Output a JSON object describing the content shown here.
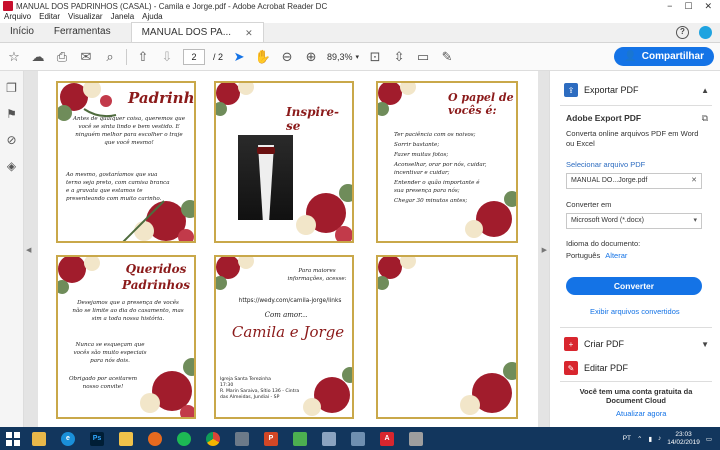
{
  "window": {
    "title": "MANUAL DOS PADRINHOS (CASAL) - Camila e Jorge.pdf - Adobe Acrobat Reader DC",
    "controls": [
      "−",
      "☐",
      "✕"
    ]
  },
  "menu": [
    "Arquivo",
    "Editar",
    "Visualizar",
    "Janela",
    "Ajuda"
  ],
  "tabs": {
    "home": "Início",
    "tools": "Ferramentas",
    "document": "MANUAL DOS PA..."
  },
  "toolbar": {
    "page_current": "2",
    "page_total": "/ 2",
    "zoom": "89,3%",
    "share_label": "Compartilhar"
  },
  "cards": {
    "padrinho": {
      "title": "Padrinho",
      "text1": "Antes de qualquer coisa, queremos que você se sinta lindo e bem vestido. E ninguém melhor para escolher o traje que você mesmo!",
      "text2": "Ao mesmo, gostaríamos que sua terno seja preto, com camisa branca e a gravata que estamos te presenteando com muito carinho."
    },
    "inspire": {
      "title": "Inspire-se"
    },
    "papel": {
      "title": "O papel de vocês é:",
      "items": [
        "Ter paciência com os noivos;",
        "Sorrir bastante;",
        "Fazer muitas fotos;",
        "Aconselhar, orar por nós, cuidar, incentivar e cuidar;",
        "Entender o quão importante é sua presença para nós;",
        "Chegar 30 minutos antes;"
      ]
    },
    "queridos": {
      "title": "Queridos Padrinhos",
      "text1": "Desejamos que a presença de vocês não se limite ao dia do casamento, mas sim a toda nossa história.",
      "text2": "Nunca se esqueçam que vocês são muito especiais para nós dois.",
      "text3": "Obrigado por aceitarem nosso convite!"
    },
    "info": {
      "line1": "Para maiores informações, acesse:",
      "url": "https://wedy.com/camila-jorge/links",
      "with_love": "Com amor...",
      "names": "Camila e Jorge",
      "addr1": "Igreja Santa Terezinha",
      "addr2": "17:30",
      "addr3": "R. Marin Saraiva, Sítio 136 - Cintra",
      "addr4": "das Almeidas, Jundiaí - SP"
    }
  },
  "panel": {
    "export_pdf": "Exportar PDF",
    "adobe_export_title": "Adobe Export PDF",
    "adobe_export_desc": "Converta online arquivos PDF em Word ou Excel",
    "select_file_label": "Selecionar arquivo PDF",
    "selected_file": "MANUAL DO...Jorge.pdf",
    "convert_to_label": "Converter em",
    "convert_format": "Microsoft Word (*.docx)",
    "doc_language_label": "Idioma do documento:",
    "doc_language": "Português",
    "change_link": "Alterar",
    "convert_button": "Converter",
    "view_converted": "Exibir arquivos convertidos",
    "create_pdf": "Criar PDF",
    "edit_pdf": "Editar PDF",
    "promo": "Você tem uma conta gratuita da Document Cloud",
    "upgrade_link": "Atualizar agora"
  },
  "taskbar": {
    "lang": "PT",
    "time": "23:03",
    "date": "14/02/2019"
  },
  "colors": {
    "accent": "#1473e6",
    "taskbar": "#12365d",
    "card_border": "#c9a84a",
    "title_red": "#8b1a1a"
  }
}
